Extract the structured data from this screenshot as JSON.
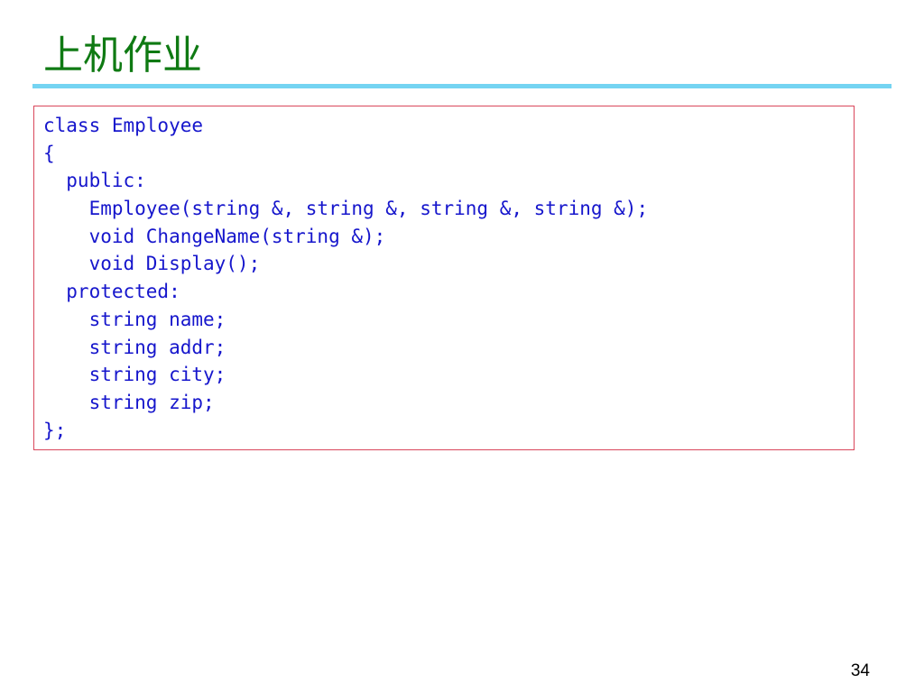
{
  "slide": {
    "title": "上机作业",
    "page_number": "34"
  },
  "code": {
    "lines": [
      "class Employee",
      "{",
      "  public:",
      "    Employee(string &, string &, string &, string &);",
      "    void ChangeName(string &);",
      "    void Display();",
      "  protected:",
      "    string name;",
      "    string addr;",
      "    string city;",
      "    string zip;",
      "};"
    ]
  },
  "colors": {
    "title": "#0f7a13",
    "title_rule": "#74d4f2",
    "code_text": "#1616cc",
    "code_border": "#d9475b"
  }
}
